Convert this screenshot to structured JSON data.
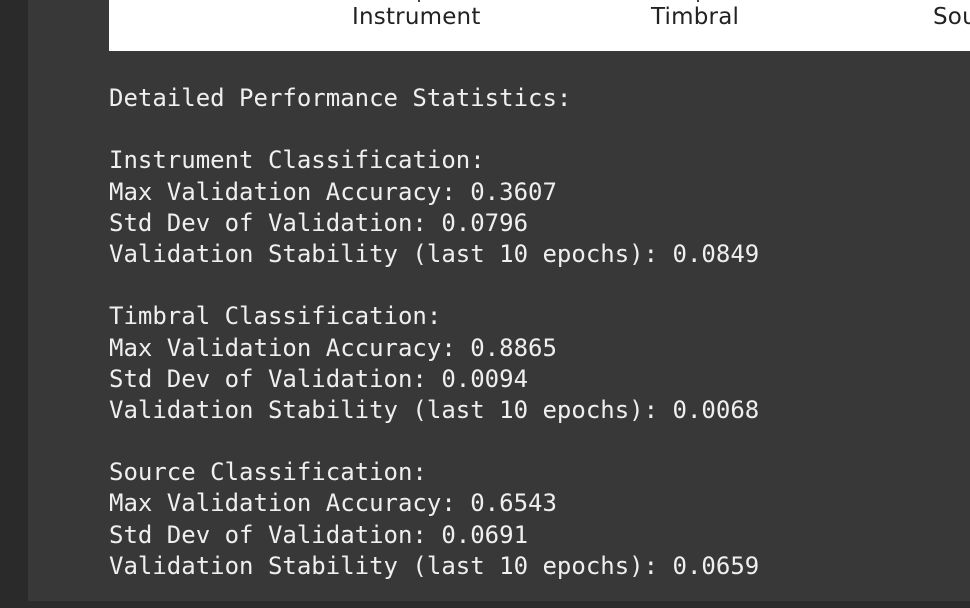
{
  "figure": {
    "x_tick_labels": [
      "Instrument",
      "Timbral",
      "Sou"
    ]
  },
  "output": {
    "heading": "Detailed Performance Statistics:",
    "sections": [
      {
        "title": "Instrument Classification:",
        "lines": [
          "Max Validation Accuracy: 0.3607",
          "Std Dev of Validation: 0.0796",
          "Validation Stability (last 10 epochs): 0.0849"
        ]
      },
      {
        "title": "Timbral Classification:",
        "lines": [
          "Max Validation Accuracy: 0.8865",
          "Std Dev of Validation: 0.0094",
          "Validation Stability (last 10 epochs): 0.0068"
        ]
      },
      {
        "title": "Source Classification:",
        "lines": [
          "Max Validation Accuracy: 0.6543",
          "Std Dev of Validation: 0.0691",
          "Validation Stability (last 10 epochs): 0.0659"
        ]
      }
    ]
  }
}
